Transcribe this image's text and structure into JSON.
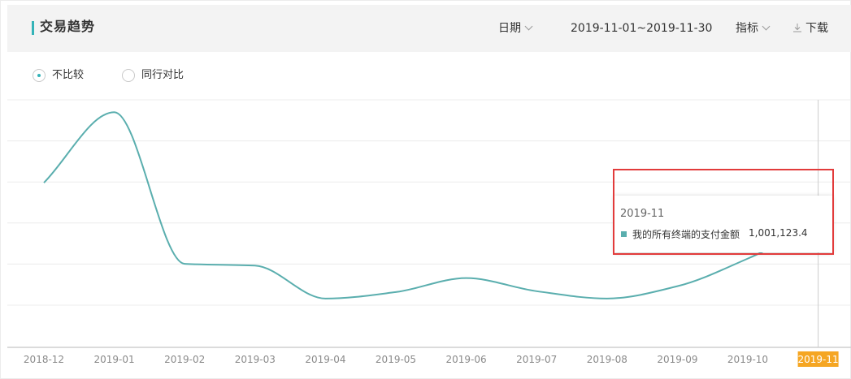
{
  "header": {
    "title": "交易趋势",
    "date_label": "日期",
    "date_range": "2019-11-01~2019-11-30",
    "metric_label": "指标",
    "download_label": "下载"
  },
  "compare": {
    "options": [
      {
        "label": "不比较",
        "checked": true
      },
      {
        "label": "同行对比",
        "checked": false
      }
    ]
  },
  "tooltip": {
    "date": "2019-11",
    "series_label": "我的所有终端的支付金额",
    "value": "1,001,123.4"
  },
  "colors": {
    "accent": "#34b3b8",
    "line": "#5aaeae",
    "highlight_tick": "#f5a623",
    "annotation": "#e23b3b",
    "header_bg": "#f3f3f3",
    "grid": "#ececec"
  },
  "chart_data": {
    "type": "line",
    "categories": [
      "2018-12",
      "2019-01",
      "2019-02",
      "2019-03",
      "2019-04",
      "2019-05",
      "2019-06",
      "2019-07",
      "2019-08",
      "2019-09",
      "2019-10",
      "2019-11"
    ],
    "series": [
      {
        "name": "我的所有终端的支付金额",
        "values": [
          1720000,
          2920000,
          340000,
          310000,
          -250000,
          -140000,
          98000,
          -125000,
          -250000,
          -40000,
          430000,
          1001123.4
        ]
      }
    ],
    "highlight_category": "2019-11",
    "grid": true,
    "y_axis_labels_visible": false
  }
}
